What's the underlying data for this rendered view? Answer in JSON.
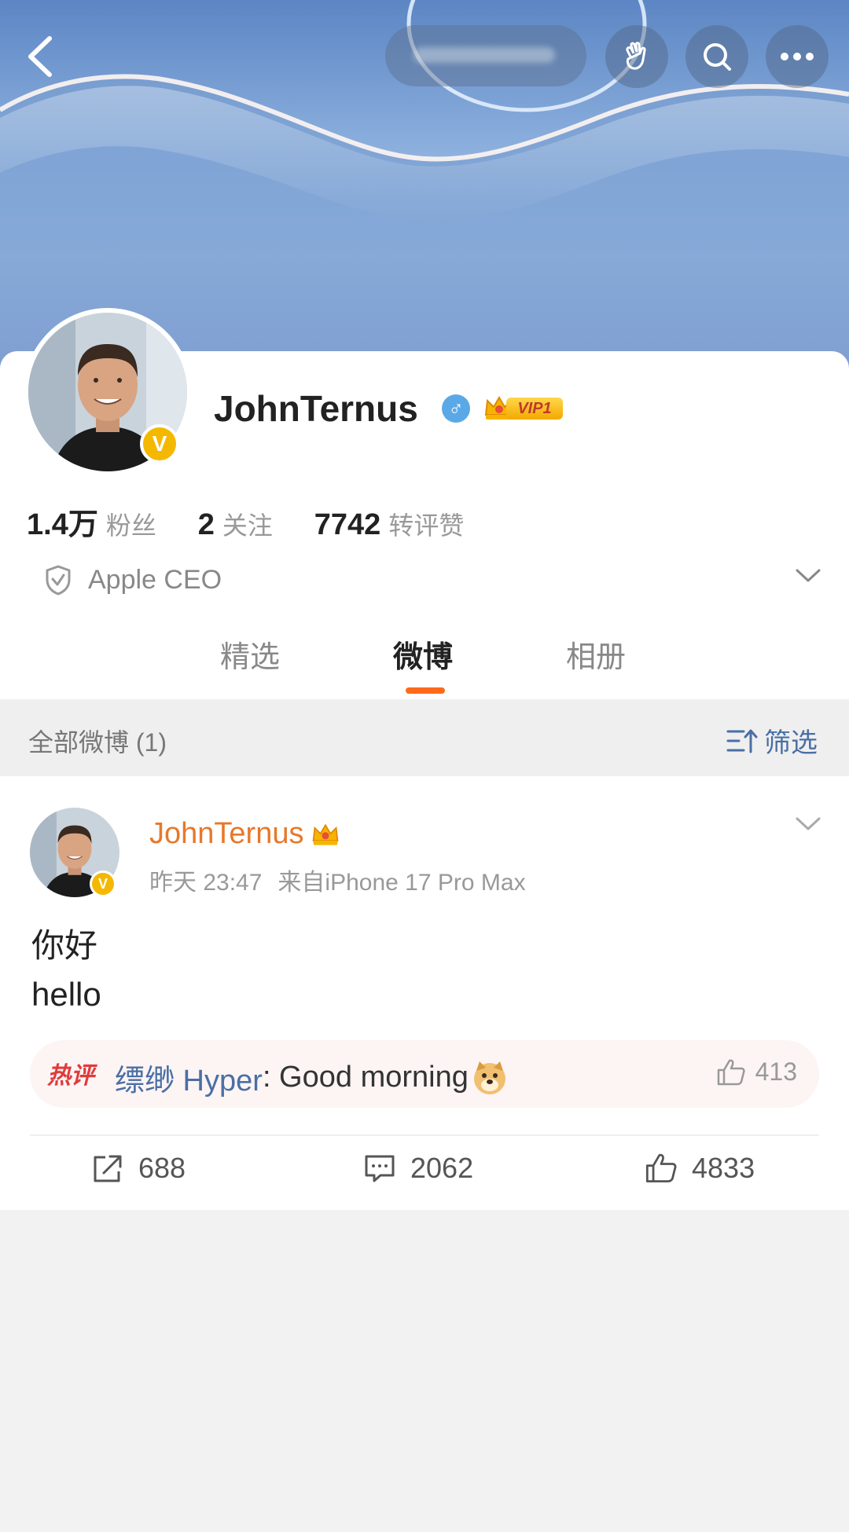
{
  "header": {
    "back_icon": "chevron-left-icon",
    "buttons": [
      "hand-wave-icon",
      "search-icon",
      "more-icon"
    ]
  },
  "profile": {
    "name": "JohnTernus",
    "gender_symbol": "♂",
    "vip_label": "VIP1",
    "stats": [
      {
        "value": "1.4万",
        "label": "粉丝"
      },
      {
        "value": "2",
        "label": "关注"
      },
      {
        "value": "7742",
        "label": "转评赞"
      }
    ],
    "certification": "Apple CEO"
  },
  "tabs": [
    {
      "label": "精选",
      "active": false
    },
    {
      "label": "微博",
      "active": true
    },
    {
      "label": "相册",
      "active": false
    }
  ],
  "filter_bar": {
    "all_label": "全部微博 (1)",
    "filter_label": "筛选"
  },
  "post": {
    "author": "JohnTernus",
    "time": "昨天 23:47",
    "source": "来自iPhone 17 Pro Max",
    "text_line1": "你好",
    "text_line2": "hello",
    "hot_comment": {
      "tag": "热评",
      "user": "缥缈 Hyper",
      "text": ": Good morning",
      "likes": "413"
    },
    "actions": {
      "repost": "688",
      "comment": "2062",
      "like": "4833"
    }
  },
  "colors": {
    "accent": "#ff6a1a",
    "author": "#e8782a",
    "link": "#4a6fa5",
    "verified": "#f5b800"
  }
}
